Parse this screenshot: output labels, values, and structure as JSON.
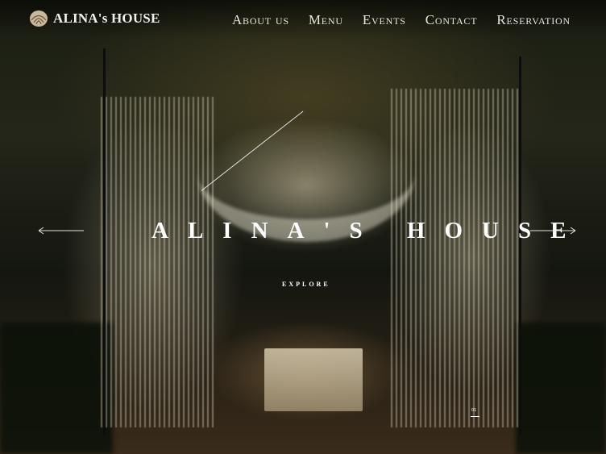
{
  "header": {
    "logo_text": "ALINA's HOUSE",
    "logo_icon": "shell-icon",
    "nav": [
      {
        "label": "About us"
      },
      {
        "label": "Menu"
      },
      {
        "label": "Events"
      },
      {
        "label": "Contact"
      },
      {
        "label": "Reservation"
      }
    ]
  },
  "hero": {
    "title": "ALINA'S HOUSE",
    "cta_label": "EXPLORE",
    "prev_icon": "arrow-left-icon",
    "next_icon": "arrow-right-icon",
    "slide_number": "01"
  },
  "colors": {
    "text": "#ffffff",
    "overlay": "#000000"
  }
}
